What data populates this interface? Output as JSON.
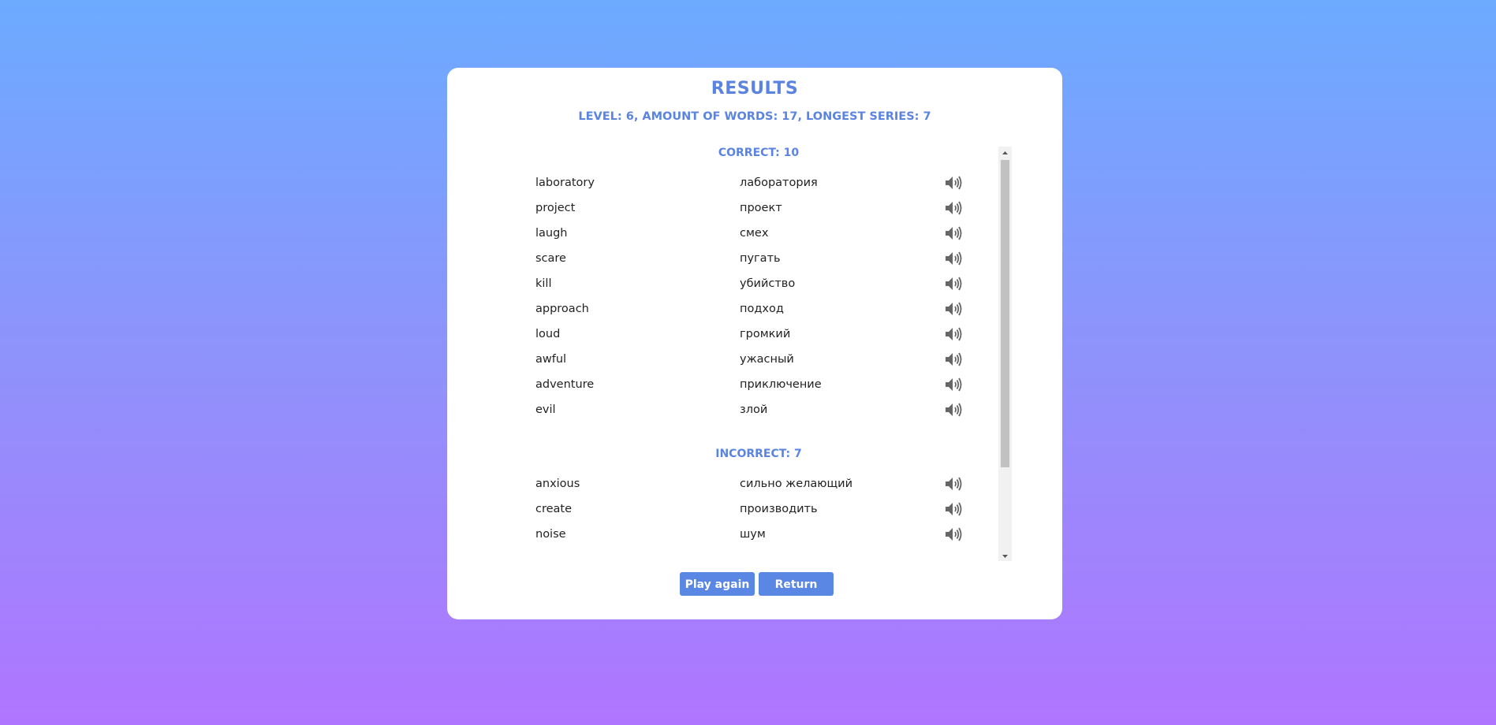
{
  "title": "RESULTS",
  "stats": "LEVEL: 6, AMOUNT OF WORDS: 17, LONGEST SERIES: 7",
  "correct": {
    "heading": "CORRECT: 10",
    "words": [
      {
        "en": "laboratory",
        "ru": "лаборатория"
      },
      {
        "en": "project",
        "ru": "проект"
      },
      {
        "en": "laugh",
        "ru": "смех"
      },
      {
        "en": "scare",
        "ru": "пугать"
      },
      {
        "en": "kill",
        "ru": "убийство"
      },
      {
        "en": "approach",
        "ru": "подход"
      },
      {
        "en": "loud",
        "ru": "громкий"
      },
      {
        "en": "awful",
        "ru": "ужасный"
      },
      {
        "en": "adventure",
        "ru": "приключение"
      },
      {
        "en": "evil",
        "ru": "злой"
      }
    ]
  },
  "incorrect": {
    "heading": "INCORRECT: 7",
    "words": [
      {
        "en": "anxious",
        "ru": "сильно желающий"
      },
      {
        "en": "create",
        "ru": "производить"
      },
      {
        "en": "noise",
        "ru": "шум"
      }
    ]
  },
  "buttons": {
    "play_again": "Play again",
    "return": "Return"
  },
  "icons": {
    "speaker": "speaker-icon"
  },
  "colors": {
    "accent": "#5b84e0",
    "button": "#5a87e3",
    "bg_top": "#6cabff",
    "bg_bottom": "#b075ff"
  }
}
